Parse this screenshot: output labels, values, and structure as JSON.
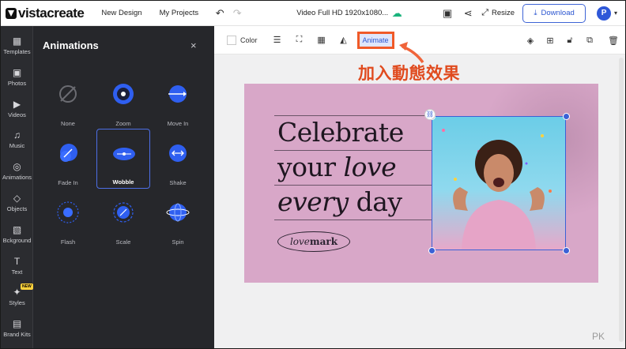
{
  "app": {
    "logo": "vistacreate"
  },
  "topbar": {
    "new_design": "New Design",
    "my_projects": "My Projects",
    "doc_name": "Video Full HD 1920x1080...",
    "resize": "Resize",
    "download": "Download",
    "avatar_initial": "P"
  },
  "rail": [
    {
      "label": "Templates",
      "icon": "grid-icon"
    },
    {
      "label": "Photos",
      "icon": "image-icon"
    },
    {
      "label": "Videos",
      "icon": "video-icon"
    },
    {
      "label": "Music",
      "icon": "music-icon"
    },
    {
      "label": "Animations",
      "icon": "animations-icon"
    },
    {
      "label": "Objects",
      "icon": "shapes-icon"
    },
    {
      "label": "Bckground",
      "icon": "background-icon"
    },
    {
      "label": "Text",
      "icon": "text-icon"
    },
    {
      "label": "Styles",
      "icon": "sparkle-icon",
      "badge": "NEW"
    },
    {
      "label": "Brand Kits",
      "icon": "brand-kit-icon"
    }
  ],
  "panel": {
    "title": "Animations",
    "close": "×"
  },
  "animations": [
    {
      "label": "None",
      "selected": false
    },
    {
      "label": "Zoom",
      "selected": false
    },
    {
      "label": "Move In",
      "selected": false
    },
    {
      "label": "Fade In",
      "selected": false
    },
    {
      "label": "Wobble",
      "selected": true
    },
    {
      "label": "Shake",
      "selected": false
    },
    {
      "label": "Flash",
      "selected": false
    },
    {
      "label": "Scale",
      "selected": false
    },
    {
      "label": "Spin",
      "selected": false
    }
  ],
  "toolbar": {
    "color": "Color",
    "animate": "Animate"
  },
  "annotation": "加入動態效果",
  "canvas": {
    "line1": "Celebrate",
    "line2a": "your ",
    "line2b": "love",
    "line3a": "every",
    "line3b": " day",
    "brand_a": "love",
    "brand_b": "mark"
  },
  "watermark": "PK",
  "colors": {
    "accent": "#2f58d8",
    "highlight": "#f05a28",
    "canvas_bg": "#d8a7c8",
    "panel_bg": "#26272b"
  }
}
